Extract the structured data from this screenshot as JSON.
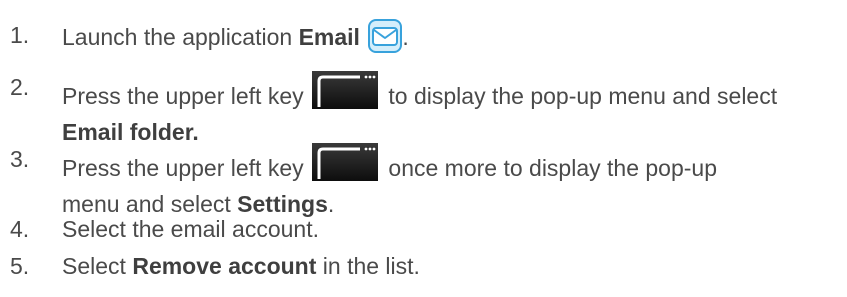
{
  "steps": [
    {
      "number": "1.",
      "parts": [
        "Launch the application ",
        "Email",
        "."
      ]
    },
    {
      "number": "2.",
      "parts": [
        "Press the upper left key",
        "to display the pop-up menu and select",
        "Email folder."
      ]
    },
    {
      "number": "3.",
      "parts": [
        "Press the upper left key",
        "once more to display the pop-up",
        "menu and select ",
        "Settings",
        "."
      ]
    },
    {
      "number": "4.",
      "parts": [
        "Select the email account."
      ]
    },
    {
      "number": "5.",
      "parts": [
        "Select ",
        "Remove account",
        " in the list."
      ]
    }
  ],
  "icons": {
    "email": "email-app-icon",
    "key": "upper-left-key-icon"
  },
  "colors": {
    "text": "#4a4a4a",
    "email_icon": "#3aa3dc"
  }
}
